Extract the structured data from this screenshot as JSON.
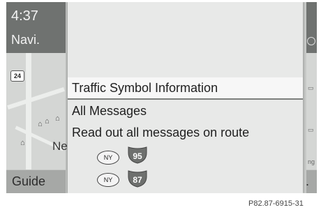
{
  "status": {
    "clock": "4:37",
    "navi_label": "Navi."
  },
  "map": {
    "road_number": "24",
    "place_fragment": "Ne"
  },
  "left_softkey": {
    "label": "Guide"
  },
  "right_softkey": {
    "label": "t."
  },
  "right_fragment": {
    "text": "ng E"
  },
  "menu": {
    "title": "Traffic Symbol Information",
    "items": [
      {
        "label": "All Messages"
      },
      {
        "label": "Read out all messages on route"
      }
    ],
    "routes": [
      {
        "state": "NY",
        "interstate": "95"
      },
      {
        "state": "NY",
        "interstate": "87"
      }
    ]
  },
  "caption": "P82.87-6915-31",
  "colors": {
    "interstate_shield": "#6e706e",
    "screen_background": "#c8cac8",
    "menu_background": "#e8e9e8"
  }
}
